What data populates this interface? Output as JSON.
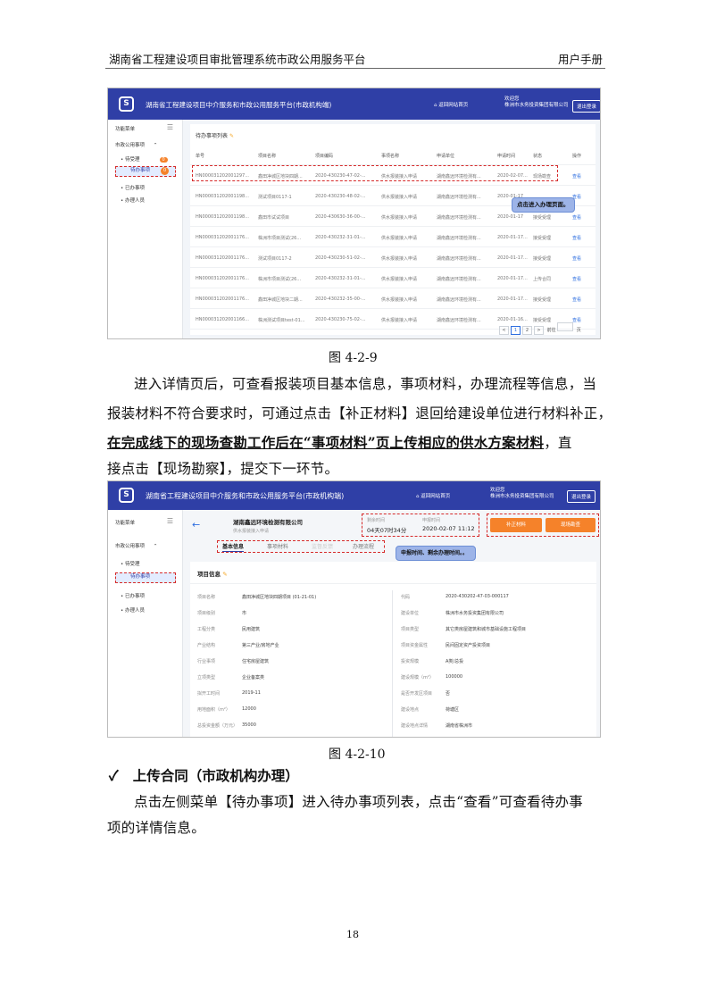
{
  "header": {
    "left": "湖南省工程建设项目审批管理系统市政公用服务平台",
    "right": "用户手册"
  },
  "screenshot1": {
    "logo": "S",
    "system_title": "湖南省工程建设项目中介服务和市政公用服务平台(市政机构端)",
    "home_link": "返回网站首页",
    "welcome_line1": "欢迎您",
    "welcome_line2": "株洲市水务投资集团有限公司",
    "logout": "退出登录",
    "sidebar": {
      "menu_label": "功能菜单",
      "group": "市政公用事项",
      "items": [
        "待受理",
        "待办事项",
        "已办事项",
        "办理人员"
      ],
      "badge1": "0",
      "badge2": "0"
    },
    "list_title": "待办事项列表",
    "columns": [
      "单号",
      "项目名称",
      "项目编码",
      "事项名称",
      "申请单位",
      "申请时间",
      "状态",
      "操作"
    ],
    "rows": [
      [
        "HN000031202001297...",
        "鑫田净城区地块四期...",
        "2020-430230-47-02-...",
        "供水报装接入申请",
        "湖南鑫远环境检测有...",
        "2020-02-07...",
        "现场勘查",
        "查看"
      ],
      [
        "HN000031202001198...",
        "测试项目0117-1",
        "2020-430230-48-02-...",
        "供水报装接入申请",
        "湖南鑫远环境检测有...",
        "2020-01-17",
        "",
        "查看"
      ],
      [
        "HN000031202001198...",
        "鑫田市试试项目",
        "2020-430630-36-00-...",
        "供水报装接入申请",
        "湖南鑫远环境检测有...",
        "2020-01-17",
        "接受受理",
        "查看"
      ],
      [
        "HN000031202001176...",
        "株洲市项目测试(26...",
        "2020-430232-31-01-...",
        "供水报装接入申请",
        "湖南鑫远环境检测有...",
        "2020-01-17...",
        "接受受理",
        "查看"
      ],
      [
        "HN000031202001176...",
        "测试项目0117-2",
        "2020-430230-51-02-...",
        "供水报装接入申请",
        "湖南鑫远环境检测有...",
        "2020-01-17...",
        "接受受理",
        "查看"
      ],
      [
        "HN000031202001176...",
        "株洲市项目测试(26...",
        "2020-430232-31-01-...",
        "供水报装接入申请",
        "湖南鑫远环境检测有...",
        "2020-01-17...",
        "上传合同",
        "查看"
      ],
      [
        "HN000031202001176...",
        "鑫田净城区地块二期...",
        "2020-430232-35-00-...",
        "供水报装接入申请",
        "湖南鑫远环境检测有...",
        "2020-01-17...",
        "接受受理",
        "查看"
      ],
      [
        "HN000031202001166...",
        "株洲测试项目test-01...",
        "2020-430230-75-02-...",
        "供水报装接入申请",
        "湖南鑫远环境检测有...",
        "2020-01-16...",
        "接受受理",
        "查看"
      ]
    ],
    "callout": "点击进入办理页面。",
    "pager": {
      "prev": "<",
      "pages": [
        "1",
        "2"
      ],
      "next": ">",
      "goto": "前往",
      "unit": "页"
    }
  },
  "caption1": "图 4-2-9",
  "para1": {
    "line1": "进入详情页后，可查看报装项目基本信息，事项材料，办理流程等信息，当",
    "line2": "报装材料不符合要求时，可通过点击【补正材料】退回给建设单位进行材料补正，",
    "line3_bold": "在完成线下的现场查勘工作后在“事项材料”页上传相应的供水方案材料",
    "line3_tail": "，直",
    "line4": "接点击【现场勘察】，提交下一环节。"
  },
  "screenshot2": {
    "logo": "S",
    "system_title": "湖南省工程建设项目中介服务和市政公用服务平台(市政机构端)",
    "home_link": "返回网站首页",
    "welcome_line1": "欢迎您",
    "welcome_line2": "株洲市水务投资集团有限公司",
    "logout": "退出登录",
    "sidebar": {
      "menu_label": "功能菜单",
      "group": "市政公用事项",
      "items": [
        "待受理",
        "待办事项",
        "已办事项",
        "办理人员"
      ]
    },
    "company": "湖南鑫远环境检测有限公司",
    "company_sub": "供水报装接入申请",
    "apply_time_label": "剩余时间",
    "apply_time_value": "04天07时34分",
    "submit_time_label": "申报时间",
    "submit_time_value": "2020-02-07 11:12",
    "btn_supplement": "补正材料",
    "btn_survey": "现场勘查",
    "tabs": [
      "基本信息",
      "事项材料",
      "监督反馈",
      "办理流程"
    ],
    "callout": "申报时间、剩余办理时间。。",
    "section_title": "项目信息",
    "left_fields": [
      [
        "项目名称",
        "鑫田净城区地块四期项目 (01-21-01)"
      ],
      [
        "项目级别",
        "市"
      ],
      [
        "工程分类",
        "民用建筑"
      ],
      [
        "产业结构",
        "第三产业/房地产业"
      ],
      [
        "行业事项",
        "住宅房屋建筑"
      ],
      [
        "立项类型",
        "企业备案类"
      ],
      [
        "拟开工时间",
        "2019-11"
      ],
      [
        "用地面积（m²）",
        "12000"
      ],
      [
        "总投资金额（万元）",
        "35000"
      ]
    ],
    "right_fields": [
      [
        "代码",
        "2020-430202-47-03-000117"
      ],
      [
        "建设单位",
        "株洲市水务投资集团有限公司"
      ],
      [
        "项目类型",
        "其它类房屋建筑和城市基础设施工程项目"
      ],
      [
        "项目资金属性",
        "民间固定资产投资项目"
      ],
      [
        "投资规模",
        "A类/总投"
      ],
      [
        "建设规模（m²）",
        "100000"
      ],
      [
        "是否开发区项目",
        "否"
      ],
      [
        "建设地点",
        "荷塘区"
      ],
      [
        "建设地点详情",
        "湖南省株洲市"
      ]
    ]
  },
  "caption2": "图 4-2-10",
  "heading": "上传合同（市政机构办理）",
  "heading_mark": "✓",
  "para2": {
    "line1": "点击左侧菜单【待办事项】进入待办事项列表，点击“查看”可查看待办事",
    "line2": "项的详情信息。"
  },
  "page_number": "18"
}
